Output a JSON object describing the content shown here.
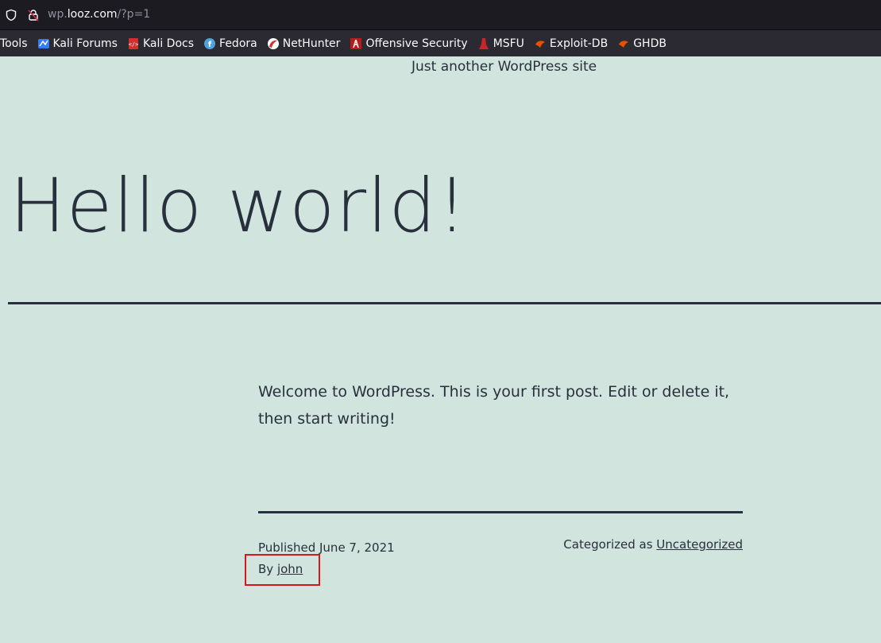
{
  "browser": {
    "url_prefix": "wp.",
    "url_host": "looz.com",
    "url_path": "/?p=1"
  },
  "bookmarks": [
    {
      "label": "Tools",
      "icon": "none"
    },
    {
      "label": "Kali Forums",
      "icon": "kali-forums-icon"
    },
    {
      "label": "Kali Docs",
      "icon": "kali-docs-icon"
    },
    {
      "label": "Fedora",
      "icon": "fedora-icon"
    },
    {
      "label": "NetHunter",
      "icon": "nethunter-icon"
    },
    {
      "label": "Offensive Security",
      "icon": "offsec-icon"
    },
    {
      "label": "MSFU",
      "icon": "msfu-icon"
    },
    {
      "label": "Exploit-DB",
      "icon": "exploitdb-icon"
    },
    {
      "label": "GHDB",
      "icon": "ghdb-icon"
    }
  ],
  "site": {
    "tagline": "Just another WordPress site"
  },
  "post": {
    "title": "Hello world!",
    "content": "Welcome to WordPress. This is your first post. Edit or delete it, then start writing!",
    "published_label": "Published",
    "published_date": "June 7, 2021",
    "by_label": "By",
    "author": "john",
    "categorized_label": "Categorized as",
    "category": "Uncategorized"
  },
  "colors": {
    "background": "#d1e4dd",
    "text": "#28303d",
    "highlight": "#d11a1a"
  }
}
